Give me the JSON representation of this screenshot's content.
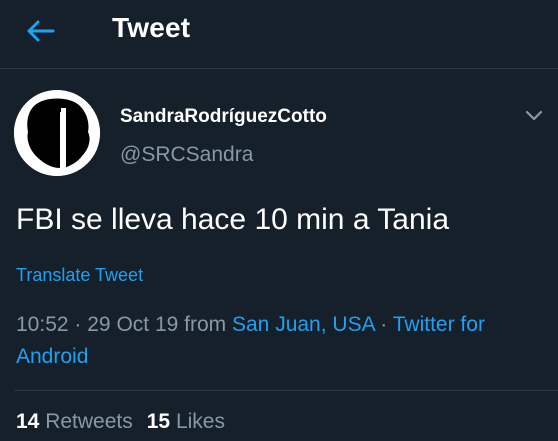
{
  "header": {
    "title": "Tweet",
    "back_icon": "arrow-left-icon"
  },
  "author": {
    "display_name": "SandraRodríguezCotto",
    "handle": "@SRCSandra",
    "menu_icon": "chevron-down-icon"
  },
  "tweet": {
    "text": "FBI se lleva hace 10 min a Tania",
    "translate_label": "Translate Tweet",
    "time": "10:52",
    "date": "29 Oct 19",
    "from_label": "from",
    "location": "San Juan, USA",
    "source": "Twitter for Android",
    "separator": "·"
  },
  "stats": {
    "retweets_count": "14",
    "retweets_label": "Retweets",
    "likes_count": "15",
    "likes_label": "Likes"
  },
  "colors": {
    "background": "#15202b",
    "accent": "#1da1f2",
    "secondary_text": "#8899a6",
    "divider": "#2b3640"
  }
}
